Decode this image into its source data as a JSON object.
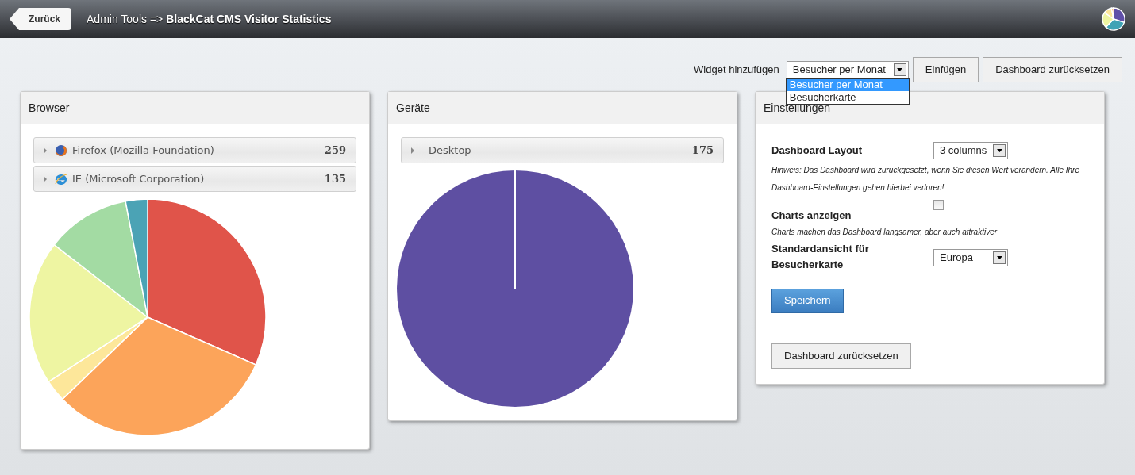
{
  "header": {
    "back_button": "Zurück",
    "breadcrumb": "Admin Tools => **BlackCat CMS Visitor Statistics**"
  },
  "toolbar": {
    "label": "Widget hinzufügen",
    "select": {
      "value": "Besucher per Monat",
      "expanded": true,
      "options": [
        {
          "label": "Besucher per Monat",
          "selected": true
        },
        {
          "label": "Besucherkarte",
          "selected": false
        }
      ]
    },
    "buttons": [
      "Einfügen",
      "Dashboard zurücksetzen"
    ]
  },
  "widgets": [
    {
      "kind": "stats",
      "title": "Browser",
      "items": [
        {
          "kind": "firefox",
          "label": "Firefox (Mozilla Foundation)",
          "count": "259"
        },
        {
          "kind": "ie",
          "label": "IE (Microsoft Corporation)",
          "count": "135"
        }
      ]
    },
    {
      "kind": "stats",
      "title": "Geräte",
      "items": [
        {
          "kind": "plain",
          "label": "Desktop",
          "count": "175"
        }
      ]
    },
    {
      "kind": "settings",
      "title": "Einstellungen",
      "layout": {
        "label": "Dashboard Layout",
        "value": "3 columns",
        "hint": "Hinweis: Das Dashboard wird zurückgesetzt, wenn Sie diesen Wert verändern. Alle Ihre Dashboard-Einstellungen gehen hierbei verloren!"
      },
      "charts": {
        "label": "Charts anzeigen",
        "checked": false,
        "hint": "Charts machen das Dashboard langsamer, aber auch attraktiver"
      },
      "map_view": {
        "label": "Standardansicht für Besucherkarte",
        "value": "Europa"
      },
      "save_button": "Speichern",
      "reset_button": "Dashboard zurücksetzen"
    }
  ]
}
